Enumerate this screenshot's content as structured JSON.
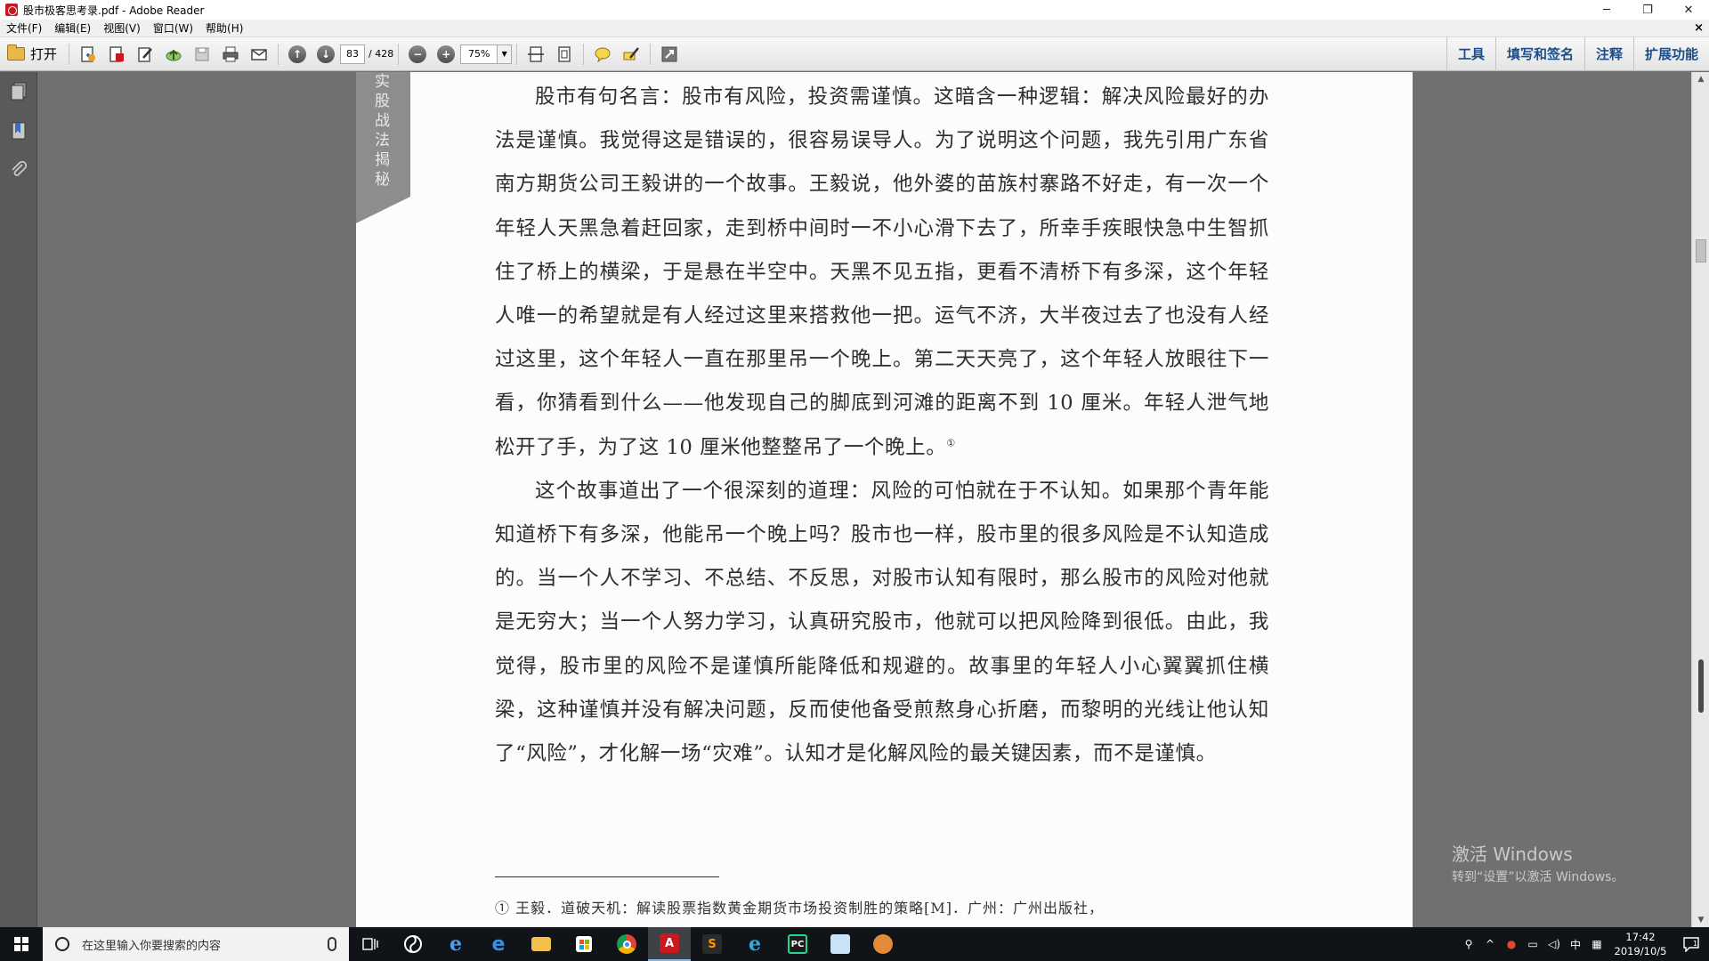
{
  "window": {
    "title": "股市极客思考录.pdf - Adobe Reader",
    "minimize_glyph": "─",
    "restore_glyph": "❐",
    "close_glyph": "✕"
  },
  "menu": {
    "items": [
      "文件(F)",
      "编辑(E)",
      "视图(V)",
      "窗口(W)",
      "帮助(H)"
    ],
    "doc_close_glyph": "×"
  },
  "toolbar": {
    "open_label": "打开",
    "page_current": "83",
    "page_total": "/ 428",
    "zoom": "75%",
    "right_panels": [
      "工具",
      "填写和签名",
      "注释",
      "扩展功能"
    ]
  },
  "page": {
    "side_tab_text": "实股战法揭秘",
    "paragraphs": [
      "股市有句名言：股市有风险，投资需谨慎。这暗含一种逻辑：解决风险最好的办法是谨慎。我觉得这是错误的，很容易误导人。为了说明这个问题，我先引用广东省南方期货公司王毅讲的一个故事。王毅说，他外婆的苗族村寨路不好走，有一次一个年轻人天黑急着赶回家，走到桥中间时一不小心滑下去了，所幸手疾眼快急中生智抓住了桥上的横梁，于是悬在半空中。天黑不见五指，更看不清桥下有多深，这个年轻人唯一的希望就是有人经过这里来搭救他一把。运气不济，大半夜过去了也没有人经过这里，这个年轻人一直在那里吊一个晚上。第二天天亮了，这个年轻人放眼往下一看，你猜看到什么——他发现自己的脚底到河滩的距离不到 10 厘米。年轻人泄气地松开了手，为了这 10 厘米他整整吊了一个晚上。",
      "这个故事道出了一个很深刻的道理：风险的可怕就在于不认知。如果那个青年能知道桥下有多深，他能吊一个晚上吗？股市也一样，股市里的很多风险是不认知造成的。当一个人不学习、不总结、不反思，对股市认知有限时，那么股市的风险对他就是无穷大；当一个人努力学习，认真研究股市，他就可以把风险降到很低。由此，我觉得，股市里的风险不是谨慎所能降低和规避的。故事里的年轻人小心翼翼抓住横梁，这种谨慎并没有解决问题，反而使他备受煎熬身心折磨，而黎明的光线让他认知了“风险”，才化解一场“灾难”。认知才是化解风险的最关键因素，而不是谨慎。"
    ],
    "footnote_mark": "①",
    "footnote": "① 王毅．道破天机：解读股票指数黄金期货市场投资制胜的策略[M]．广州：广州出版社，"
  },
  "watermark": {
    "line1": "激活 Windows",
    "line2": "转到“设置”以激活 Windows。"
  },
  "taskbar": {
    "search_placeholder": "在这里输入你要搜索的内容",
    "apps": [
      "task-view",
      "app-swirl",
      "ie-legacy",
      "edge",
      "file-explorer",
      "store",
      "chrome",
      "adobe-reader",
      "sublime",
      "ie",
      "pycharm",
      "notes",
      "game"
    ],
    "tray_ime": "中",
    "time": "17:42",
    "date": "2019/10/5",
    "notif_count": "1"
  },
  "colors": {
    "adobe_red": "#c8191f",
    "panel_link": "#1a4d8c",
    "doc_bg": "#707070",
    "taskbar_bg": "#101418"
  }
}
